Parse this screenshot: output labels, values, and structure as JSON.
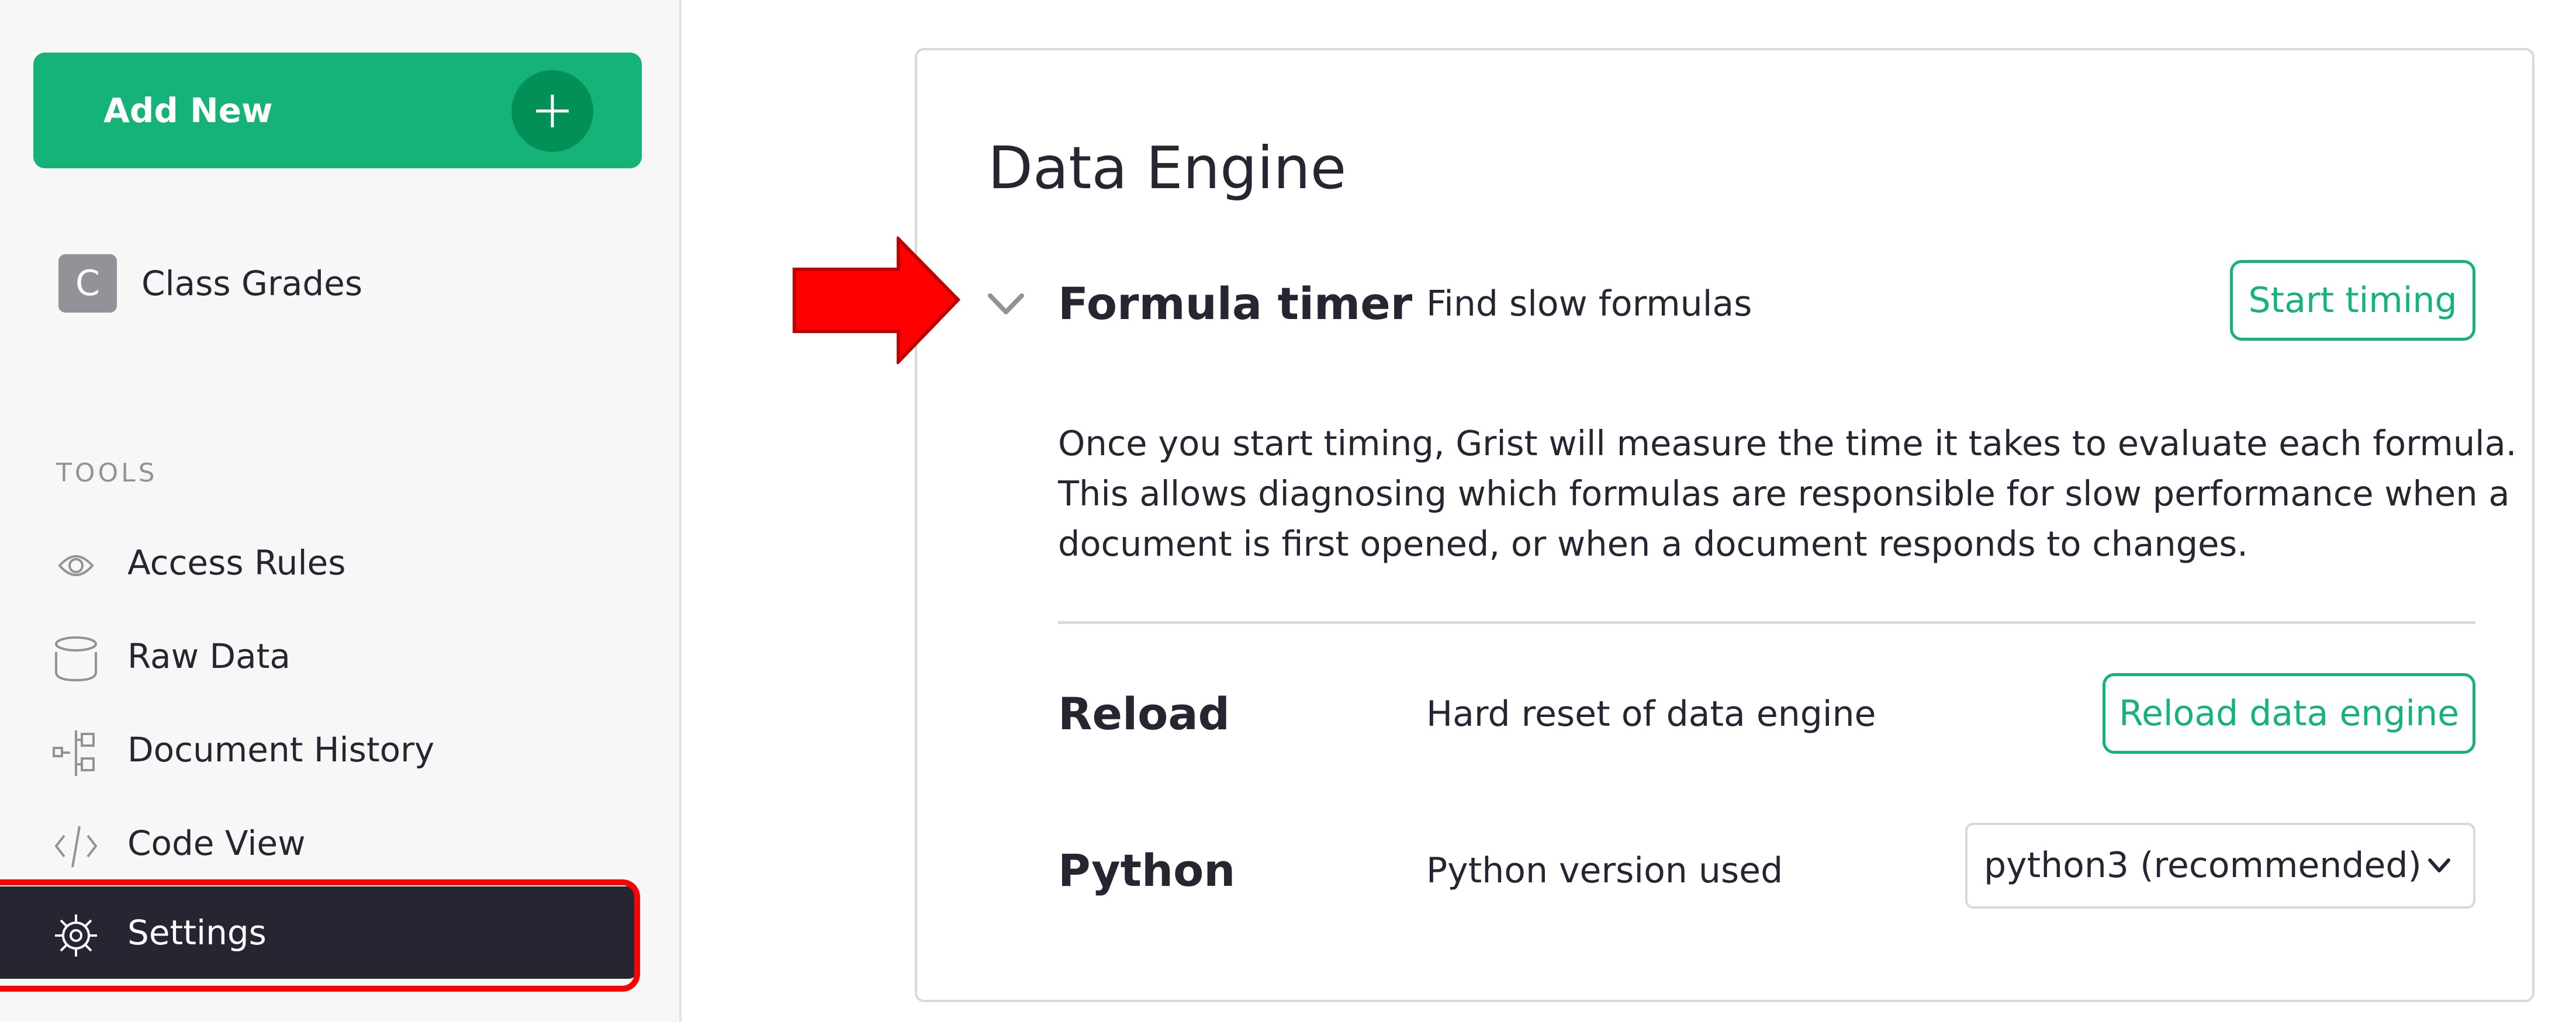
{
  "sidebar": {
    "add_new_label": "Add New",
    "add_new_icon": "plus-icon",
    "document": {
      "initial": "C",
      "name": "Class Grades"
    },
    "tools_heading": "TOOLS",
    "items": [
      {
        "label": "Access Rules",
        "icon": "eye-icon",
        "active": false
      },
      {
        "label": "Raw Data",
        "icon": "database-icon",
        "active": false
      },
      {
        "label": "Document History",
        "icon": "history-tree-icon",
        "active": false
      },
      {
        "label": "Code View",
        "icon": "code-icon",
        "active": false
      },
      {
        "label": "Settings",
        "icon": "gear-icon",
        "active": true
      }
    ]
  },
  "main": {
    "title": "Data Engine",
    "formula_timer": {
      "label": "Formula timer",
      "description": "Find slow formulas",
      "button_label": "Start timing",
      "expanded": true,
      "details": [
        "Once you start timing, Grist will measure the time it takes to evaluate each formula.",
        "This allows diagnosing which formulas are responsible for slow performance when a",
        "document is first opened, or when a document responds to changes."
      ]
    },
    "reload": {
      "label": "Reload",
      "description": "Hard reset of data engine",
      "button_label": "Reload data engine"
    },
    "python": {
      "label": "Python",
      "description": "Python version used",
      "selected_option": "python3 (recommended)"
    }
  },
  "annotations": {
    "arrow_target": "Formula timer",
    "highlight_target": "Settings",
    "annotation_color": "#ff0000"
  },
  "colors": {
    "accent_green": "#16b378",
    "accent_green_dark": "#009058",
    "active_nav_bg": "#262633",
    "sidebar_bg": "#f7f7f7",
    "muted_text": "#929299"
  }
}
